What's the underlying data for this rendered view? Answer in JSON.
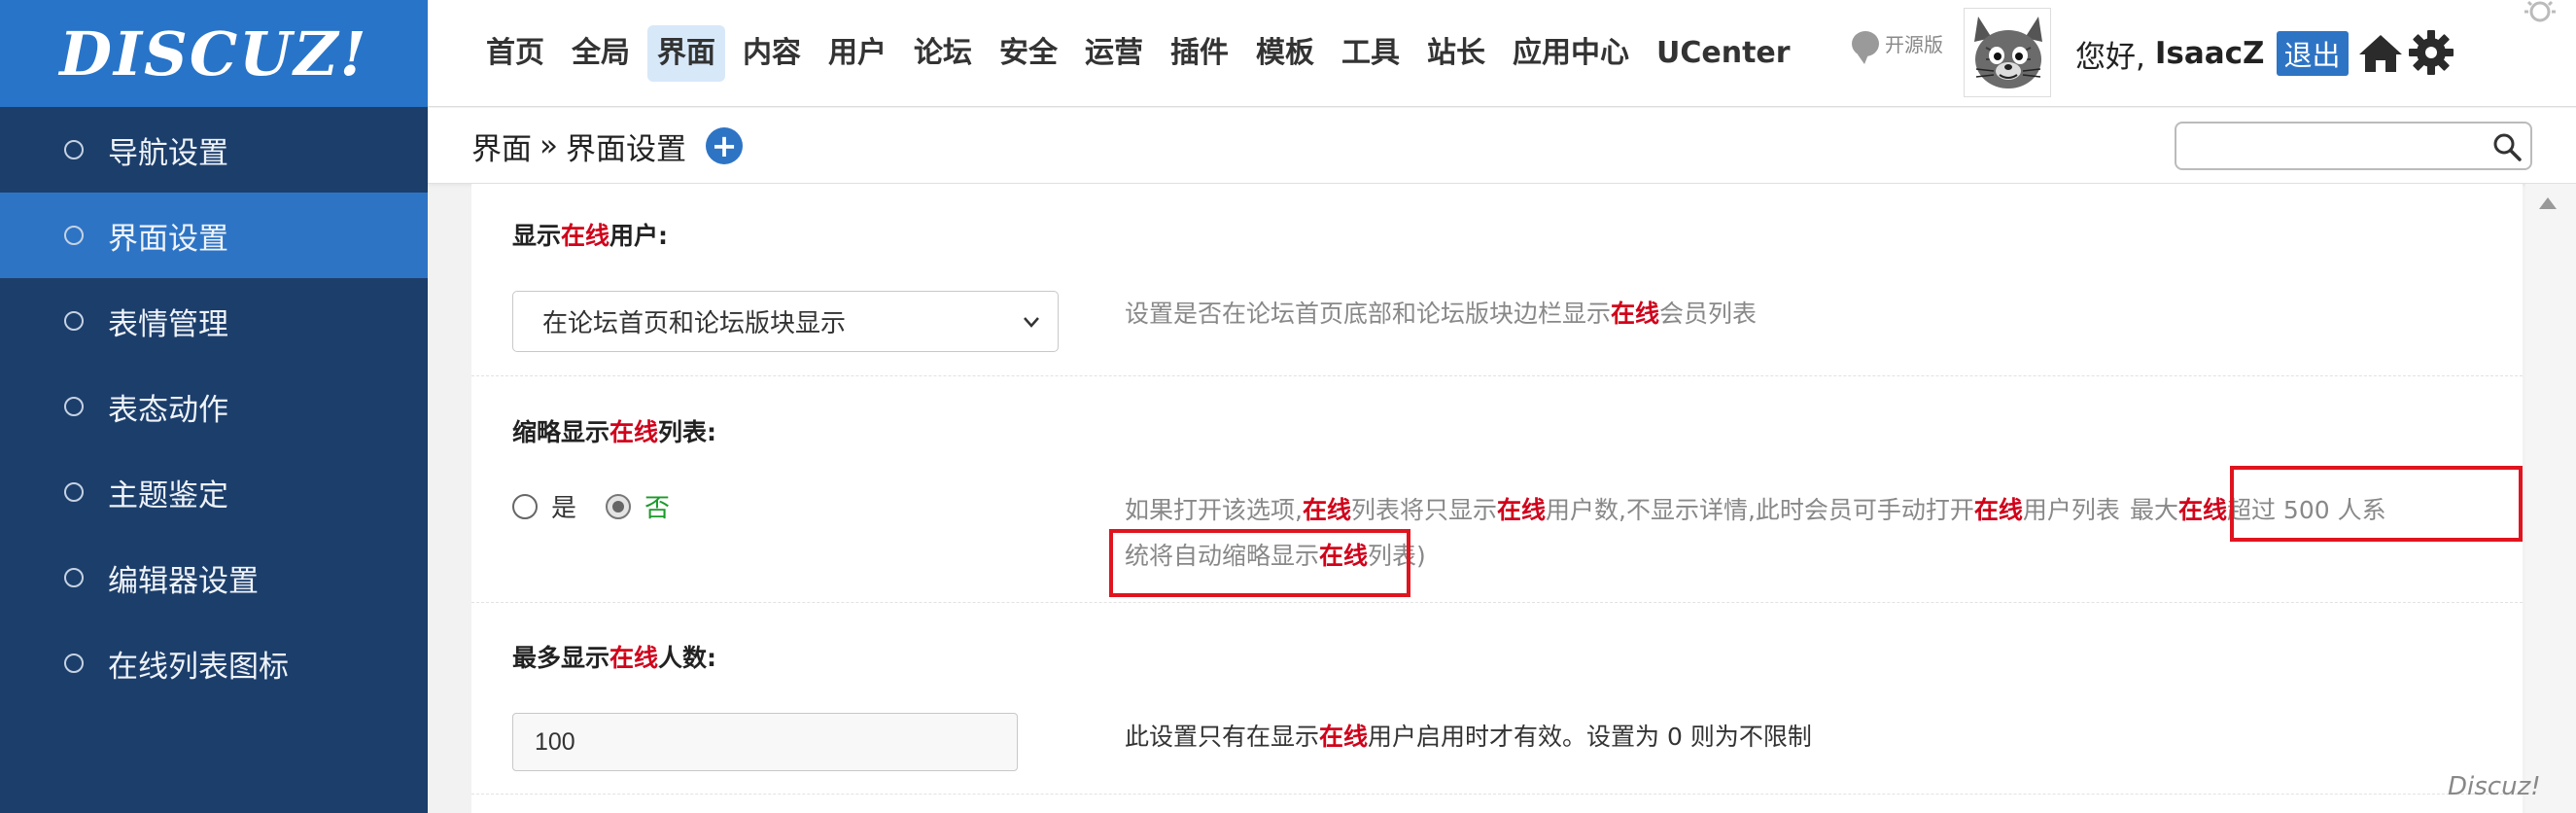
{
  "logo": {
    "text": "DISCUZ!"
  },
  "sidebar": {
    "items": [
      {
        "label": "导航设置",
        "active": false
      },
      {
        "label": "界面设置",
        "active": true
      },
      {
        "label": "表情管理",
        "active": false
      },
      {
        "label": "表态动作",
        "active": false
      },
      {
        "label": "主题鉴定",
        "active": false
      },
      {
        "label": "编辑器设置",
        "active": false
      },
      {
        "label": "在线列表图标",
        "active": false
      }
    ]
  },
  "nav": {
    "items": [
      "首页",
      "全局",
      "界面",
      "内容",
      "用户",
      "论坛",
      "安全",
      "运营",
      "插件",
      "模板",
      "工具",
      "站长",
      "应用中心",
      "UCenter"
    ],
    "active": "界面"
  },
  "header": {
    "edition": "开源版",
    "greeting": "您好,",
    "username": "IsaacZ",
    "logout": "退出"
  },
  "breadcrumb": {
    "parent": "界面",
    "separator": "»",
    "current": "界面设置",
    "add": "+"
  },
  "search": {
    "value": "",
    "placeholder": ""
  },
  "settings": {
    "show_online": {
      "label_pre": "显示",
      "label_hl": "在线",
      "label_post": "用户:",
      "select_value": "在论坛首页和论坛版块显示",
      "desc_pre": "设置是否在论坛首页底部和论坛版块边栏显示",
      "desc_hl": "在线",
      "desc_post": "会员列表"
    },
    "compact_list": {
      "label_pre": "缩略显示",
      "label_hl": "在线",
      "label_post": "列表:",
      "yes": "是",
      "no": "否",
      "selected": "否",
      "line1_a": "如果打开该选项,",
      "line1_b": "在线",
      "line1_c": "列表将只显示",
      "line1_d": "在线",
      "line1_e": "用户数,不显示详情,此时会员可手动打开",
      "line1_f": "在线",
      "line1_g": "用户列表",
      "line1_h": "最大",
      "line1_i": "在线",
      "line1_j": "超过 500 人系",
      "line2_a": "统将自动缩略显示",
      "line2_b": "在线",
      "line2_c": "列表)"
    },
    "max_online": {
      "label_pre": "最多显示",
      "label_hl": "在线",
      "label_post": "人数:",
      "value": "100",
      "desc_pre": "此设置只有在显示",
      "desc_hl": "在线",
      "desc_post": "用户启用时才有效。设置为 0 则为不限制"
    }
  },
  "watermark": "Discuz!",
  "colors": {
    "brand": "#2874c8",
    "sidebar": "#1c3e6b",
    "sidebar_active": "#2e74c5",
    "highlight": "#d0021b",
    "annotation": "#e0141e"
  }
}
